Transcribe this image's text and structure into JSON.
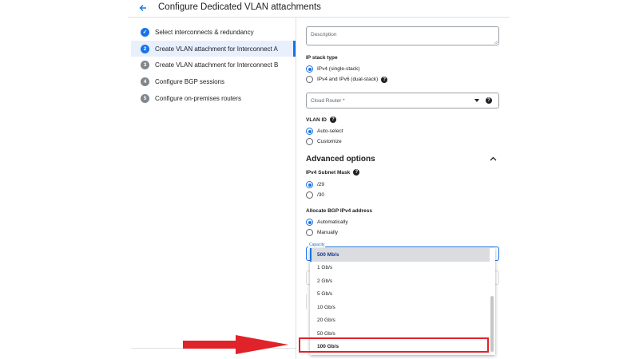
{
  "header": {
    "title": "Configure Dedicated VLAN attachments",
    "back_icon": "arrow-left-icon"
  },
  "stepper": {
    "steps": [
      {
        "num": "✓",
        "label": "Select interconnects & redundancy",
        "state": "done"
      },
      {
        "num": "2",
        "label": "Create VLAN attachment for Interconnect A",
        "state": "current"
      },
      {
        "num": "3",
        "label": "Create VLAN attachment for Interconnect B",
        "state": "pending"
      },
      {
        "num": "4",
        "label": "Configure BGP sessions",
        "state": "pending"
      },
      {
        "num": "5",
        "label": "Configure on-premises routers",
        "state": "pending"
      }
    ]
  },
  "form": {
    "description_placeholder": "Description",
    "ip_stack": {
      "label": "IP stack type",
      "options": [
        "IPv4 (single-stack)",
        "IPv4 and IPv6 (dual-stack)"
      ],
      "selected": "IPv4 (single-stack)"
    },
    "cloud_router": {
      "placeholder": "Cloud Router",
      "required_mark": "*"
    },
    "vlan_id": {
      "label": "VLAN ID",
      "options": [
        "Auto-select",
        "Customize"
      ],
      "selected": "Auto-select"
    },
    "advanced": {
      "title": "Advanced options",
      "expanded": true
    },
    "subnet_mask": {
      "label": "IPv4 Subnet Mask",
      "options": [
        "/29",
        "/30"
      ],
      "selected": "/29"
    },
    "bgp_address": {
      "label": "Allocate BGP IPv4 address",
      "options": [
        "Automatically",
        "Manually"
      ],
      "selected": "Automatically"
    },
    "capacity": {
      "label": "Capacity",
      "selected": "500 Mb/s",
      "options": [
        "500 Mb/s",
        "1 Gb/s",
        "2 Gb/s",
        "5 Gb/s",
        "10 Gb/s",
        "20 Gb/s",
        "50 Gb/s",
        "100 Gb/s"
      ],
      "highlighted": "100 Gb/s"
    }
  },
  "colors": {
    "accent": "#1a73e8",
    "annotation_red": "#e0232a"
  }
}
